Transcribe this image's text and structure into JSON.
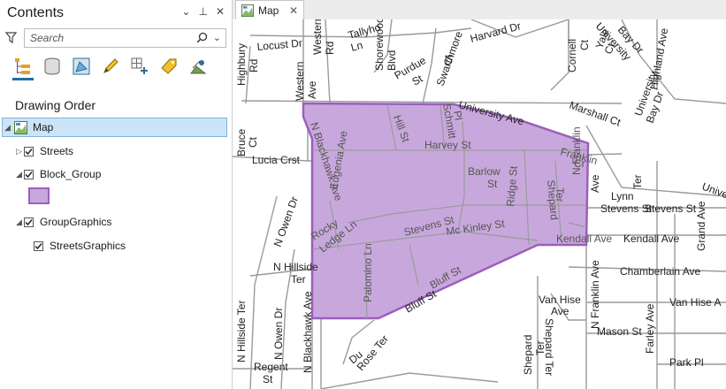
{
  "contents_pane": {
    "title": "Contents",
    "search_placeholder": "Search",
    "toolbar": [
      {
        "name": "list-by-drawing-order-icon"
      },
      {
        "name": "list-by-data-source-icon"
      },
      {
        "name": "list-by-selection-icon"
      },
      {
        "name": "list-by-editing-icon"
      },
      {
        "name": "list-by-snapping-icon"
      },
      {
        "name": "list-by-labeling-icon"
      },
      {
        "name": "list-by-perspective-imagery-icon"
      }
    ],
    "section_title": "Drawing Order",
    "items": [
      {
        "label": "Map"
      },
      {
        "label": "Streets",
        "checked": true
      },
      {
        "label": "Block_Group",
        "checked": true
      },
      {
        "label": "GroupGraphics",
        "checked": true
      },
      {
        "label": "StreetsGraphics",
        "checked": true
      }
    ],
    "swatch_fill": "#c8a8dc",
    "swatch_outline": "#9a5fbd"
  },
  "map_tab": {
    "label": "Map"
  },
  "map": {
    "polygon_fill": "#c8a8dc",
    "polygon_outline": "#9a5fbd",
    "street_color": "#9a9a9a",
    "labels": [
      "Locust Dr",
      "Tallyho",
      "Ln",
      "Western",
      "Rd",
      "Shorewood",
      "Blvd",
      "Purdue",
      "St",
      "Swarthmore",
      "Ct",
      "Harvard Dr",
      "Cornell",
      "Ct",
      "Yale",
      "Ct",
      "University",
      "Bay Dr",
      "Highland Ave",
      "Highbury",
      "Rd",
      "Western",
      "Ave",
      "University Ave",
      "Marshall Ct",
      "University",
      "Bay Dr",
      "Bruce",
      "Ct",
      "Lucia Crst",
      "Hill St",
      "Schmitt",
      "Pl",
      "Harvey St",
      "N Blackhawk Ave",
      "Eugenia Ave",
      "Franklin",
      "Cr",
      "Barlow",
      "St",
      "Ridge St",
      "Shepard",
      "Ter",
      "N Franklin",
      "Ave",
      "Lynn",
      "Ter",
      "Stevens St",
      "Stevens St",
      "Univer",
      "N Owen Dr",
      "Rocky",
      "Ledge Ln",
      "Stevens St",
      "Mc Kinley St",
      "Kendall Ave",
      "Kendall Ave",
      "Grand Ave",
      "Shepard Ter",
      "N Hillside",
      "Ter",
      "Palomino Ln",
      "Bluff St",
      "Chamberlain Ave",
      "Bluff St",
      "Van Hise",
      "Ave",
      "N Franklin Ave",
      "Van Hise A",
      "N Hillside Ter",
      "N Owen Dr",
      "N Blackhawk Ave",
      "Du",
      "Rose Ter",
      "Shepard",
      "Ter",
      "Mason St",
      "Farley Ave",
      "Regent",
      "St",
      "Park Pl"
    ]
  }
}
